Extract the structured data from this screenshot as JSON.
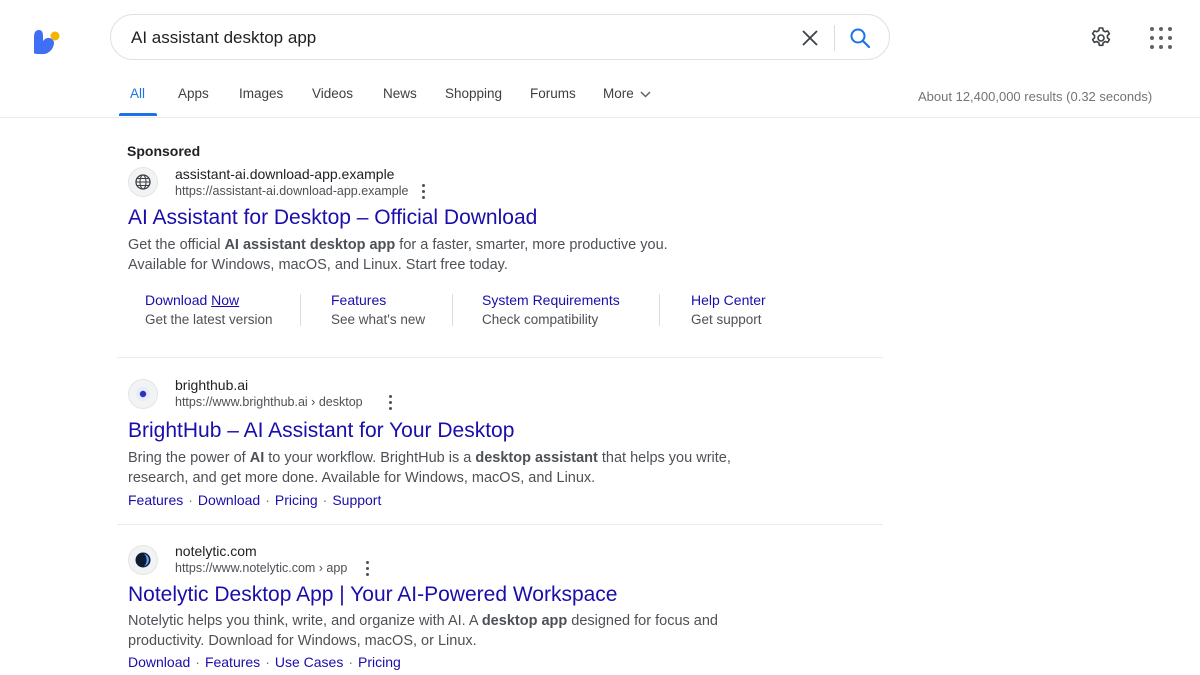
{
  "search": {
    "query": "AI assistant desktop app"
  },
  "tabs": [
    {
      "label": "All"
    },
    {
      "label": "Apps"
    },
    {
      "label": "Images"
    },
    {
      "label": "Videos"
    },
    {
      "label": "News"
    },
    {
      "label": "Shopping"
    },
    {
      "label": "Forums"
    },
    {
      "label": "More"
    }
  ],
  "stats": "About 12,400,000 results (0.32 seconds)",
  "ad": {
    "sponsored_label": "Sponsored",
    "site_name": "assistant-ai.download-app.example",
    "site_url": "https://assistant-ai.download-app.example",
    "title": "AI Assistant for Desktop – Official Download",
    "snippet": {
      "p1": "Get the official ",
      "b1": "AI assistant desktop app",
      "p2": " for a faster, smarter, more productive you.",
      "line2": "Available for Windows, macOS, and Linux. Start free today."
    },
    "sitelinks": [
      {
        "title_a": "Download ",
        "title_b": "Now",
        "desc": "Get the latest version"
      },
      {
        "title": "Features",
        "desc": "See what's new"
      },
      {
        "title": "System Requirements",
        "desc": "Check compatibility"
      },
      {
        "title": "Help Center",
        "desc": "Get support"
      }
    ]
  },
  "results": [
    {
      "site_name": "brighthub.ai",
      "site_url": "https://www.brighthub.ai › desktop",
      "title": "BrightHub – AI Assistant for Your Desktop",
      "snippet": {
        "p1": "Bring the power of ",
        "b1": "AI",
        "p2": " to your workflow. BrightHub is a ",
        "b2": "desktop assistant",
        "p3": " that helps you write,",
        "line2": "research, and get more done. Available for Windows, macOS, and Linux."
      },
      "links": [
        "Features",
        "Download",
        "Pricing",
        "Support"
      ]
    },
    {
      "site_name": "notelytic.com",
      "site_url": "https://www.notelytic.com › app",
      "title": "Notelytic Desktop App | Your AI-Powered Workspace",
      "snippet": {
        "p1": "Notelytic helps you think, write, and organize with AI. A ",
        "b1": "desktop app",
        "p2": " designed for focus and",
        "line2": "productivity. Download for Windows, macOS, or Linux."
      },
      "links": [
        "Download",
        "Features",
        "Use Cases",
        "Pricing"
      ]
    }
  ],
  "colors": {
    "link": "#1a0dab",
    "accent": "#1a73e8",
    "brand_blue": "#3f6ff5",
    "brand_yellow": "#f5b400"
  },
  "icons": [
    "app-logo",
    "clear-icon",
    "search-icon",
    "gear-icon",
    "apps-grid-icon",
    "globe-icon",
    "kebab-menu-icon",
    "chevron-down-icon"
  ]
}
